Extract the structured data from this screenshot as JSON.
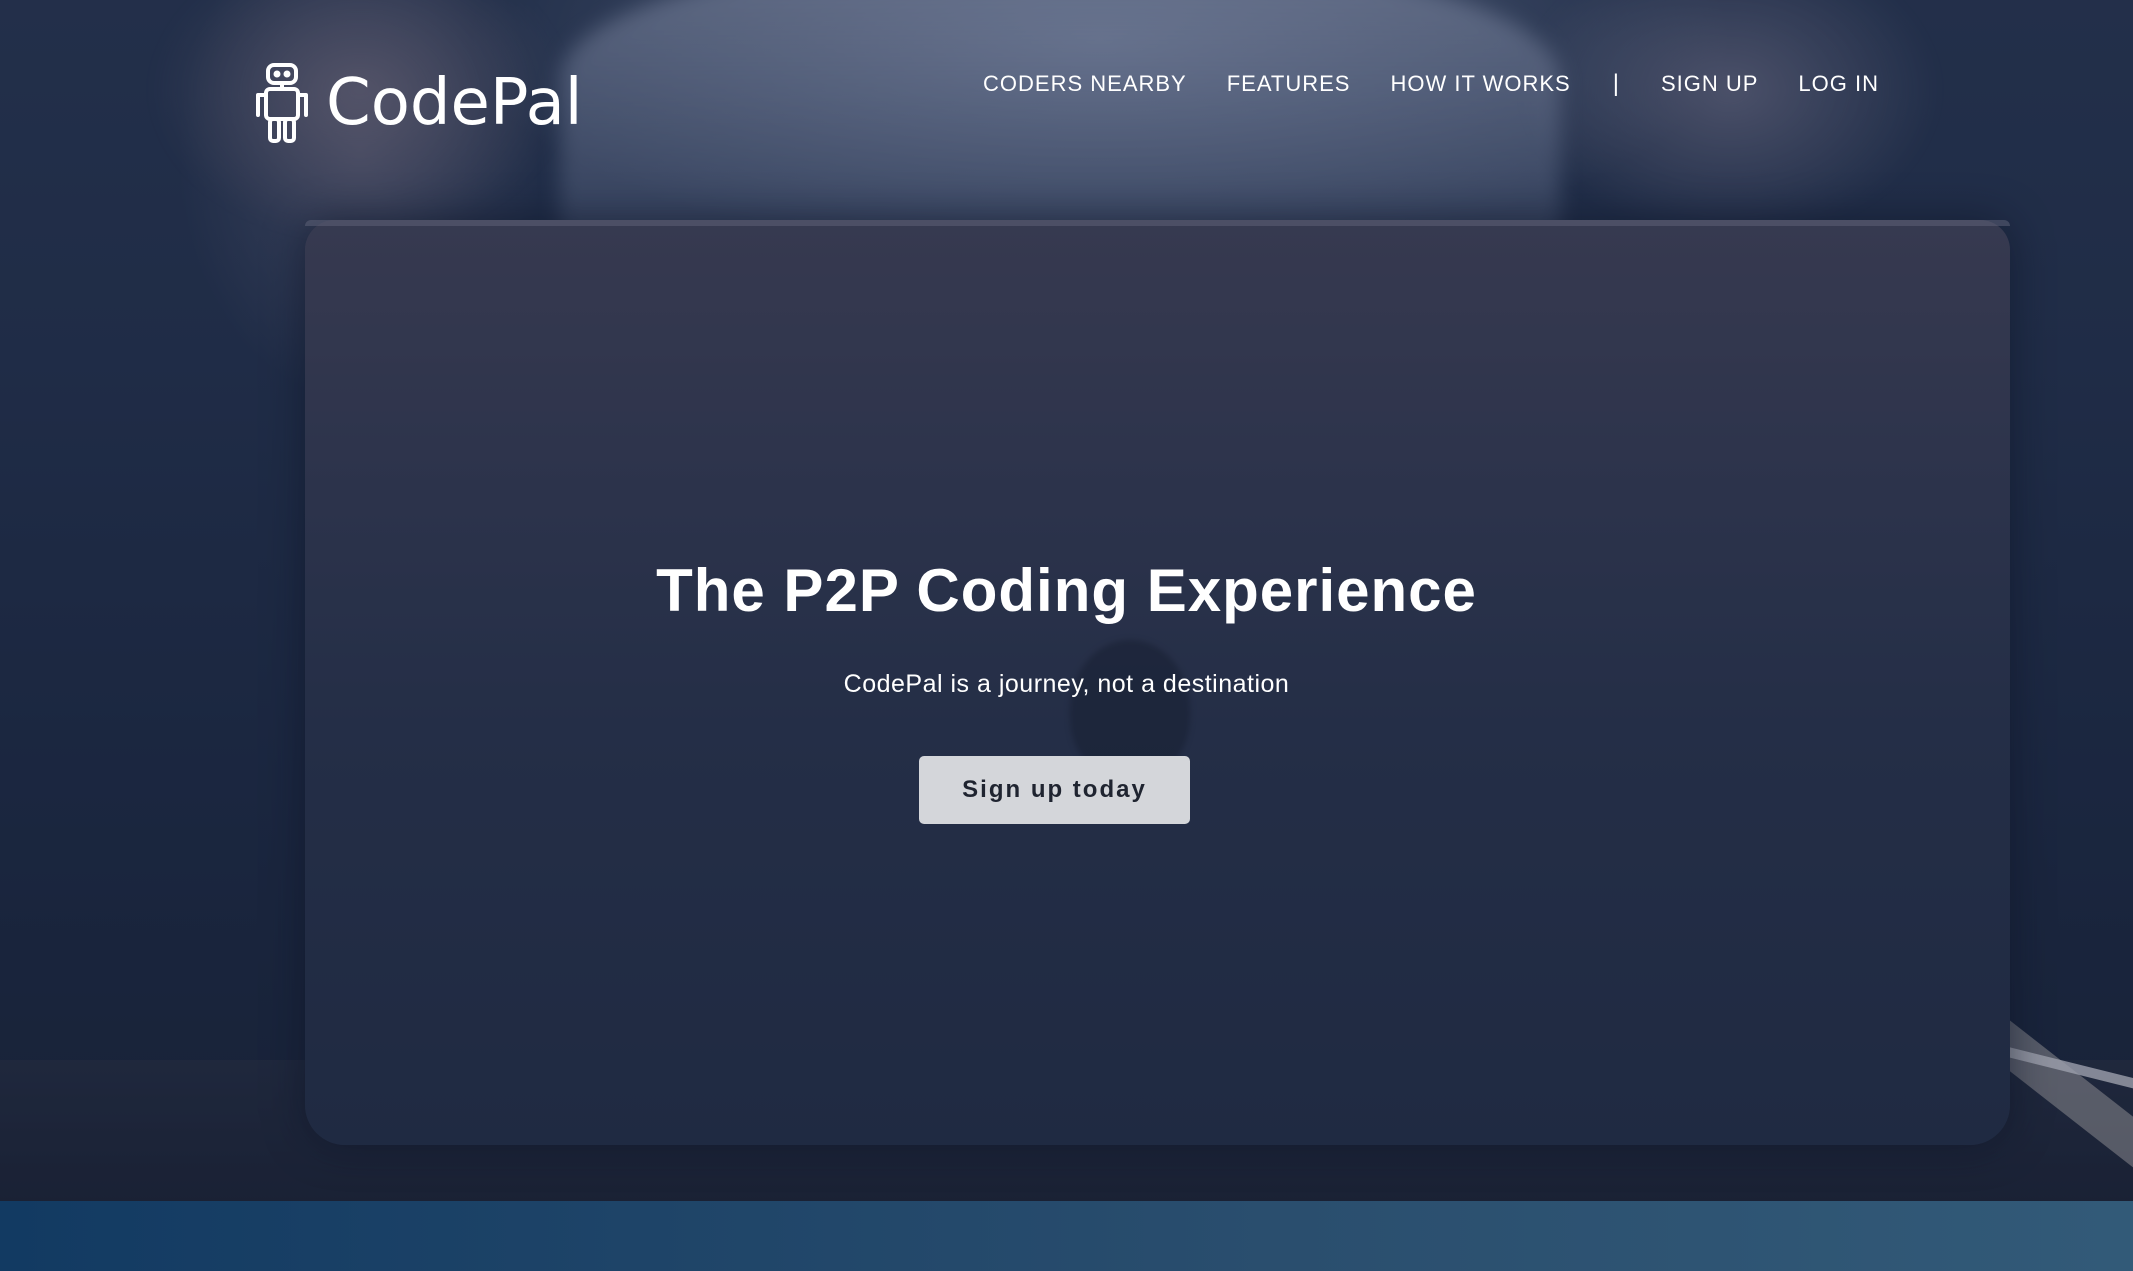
{
  "brand": {
    "name": "CodePal",
    "logo_icon": "robot-icon"
  },
  "nav": {
    "items": [
      {
        "label": "CODERS NEARBY"
      },
      {
        "label": "FEATURES"
      },
      {
        "label": "HOW IT WORKS"
      }
    ],
    "separator": "|",
    "auth": [
      {
        "label": "SIGN UP"
      },
      {
        "label": "LOG IN"
      }
    ]
  },
  "hero": {
    "title": "The P2P Coding Experience",
    "subtitle": "CodePal is a journey, not a destination",
    "cta_label": "Sign up today"
  },
  "colors": {
    "text": "#ffffff",
    "cta_bg": "#d4d6da",
    "cta_text": "#1f2430",
    "bottom_band": "#1c4366"
  }
}
